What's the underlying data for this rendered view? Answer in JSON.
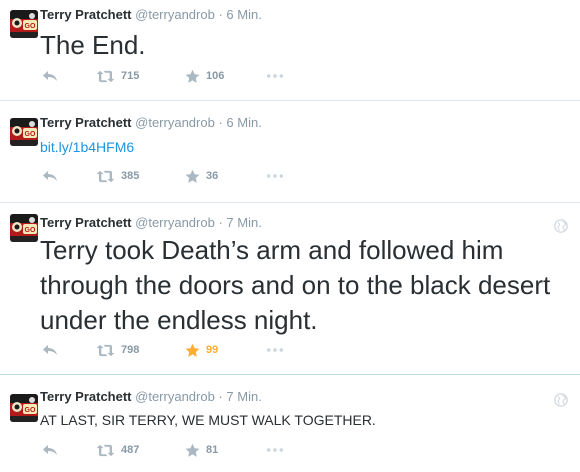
{
  "tweets": [
    {
      "name": "Terry Pratchett",
      "handle": "@terryandrob",
      "separator": "·",
      "time": "6 Min.",
      "text": "The End.",
      "retweets": "715",
      "favorites": "106",
      "favorited": false
    },
    {
      "name": "Terry Pratchett",
      "handle": "@terryandrob",
      "separator": "·",
      "time": "6 Min.",
      "text": "bit.ly/1b4HFM6",
      "retweets": "385",
      "favorites": "36",
      "favorited": false
    },
    {
      "name": "Terry Pratchett",
      "handle": "@terryandrob",
      "separator": "·",
      "time": "7 Min.",
      "text": "Terry took Death’s arm and followed him through the doors and on to the black desert under the endless night.",
      "retweets": "798",
      "favorites": "99",
      "favorited": true
    },
    {
      "name": "Terry Pratchett",
      "handle": "@terryandrob",
      "separator": "·",
      "time": "7 Min.",
      "text": "AT LAST, SIR TERRY, WE MUST WALK TOGETHER.",
      "retweets": "487",
      "favorites": "81",
      "favorited": false
    }
  ],
  "icons": {
    "reply": "reply-icon",
    "retweet": "retweet-icon",
    "favorite": "star-icon",
    "more": "more-dots-icon",
    "globe": "globe-icon"
  },
  "colors": {
    "name": "#292f33",
    "meta": "#8899a6",
    "link": "#1b95e0",
    "favorite_active": "#ffac33",
    "divider": "#e1e8ed",
    "divider_active": "#bcdbe8"
  }
}
